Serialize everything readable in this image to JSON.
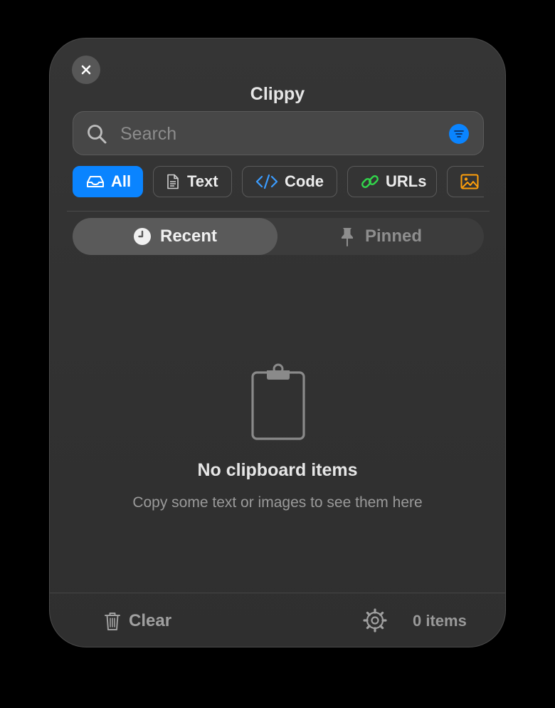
{
  "window": {
    "title": "Clippy"
  },
  "search": {
    "placeholder": "Search",
    "value": ""
  },
  "filters": [
    {
      "label": "All",
      "icon": "tray-icon",
      "active": true
    },
    {
      "label": "Text",
      "icon": "document-icon",
      "active": false
    },
    {
      "label": "Code",
      "icon": "code-icon",
      "active": false
    },
    {
      "label": "URLs",
      "icon": "link-icon",
      "active": false
    },
    {
      "label": "",
      "icon": "image-icon",
      "active": false
    }
  ],
  "tabs": {
    "recent": "Recent",
    "pinned": "Pinned"
  },
  "empty_state": {
    "title": "No clipboard items",
    "subtitle": "Copy some text or images to see them here",
    "icon": "clipboard-icon"
  },
  "footer": {
    "clear_label": "Clear",
    "count_label": "0 items"
  },
  "colors": {
    "accent": "#0a84ff",
    "code": "#3b9cff",
    "link": "#32d74b",
    "image": "#ff9f0a"
  }
}
